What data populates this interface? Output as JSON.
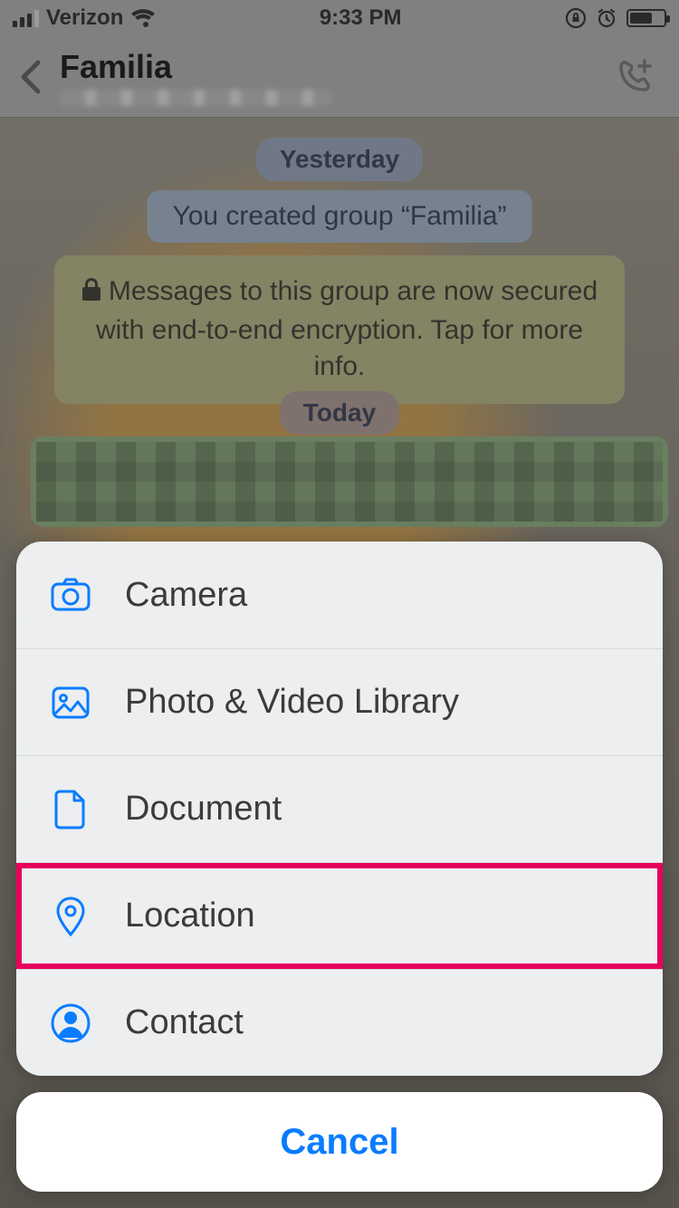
{
  "status": {
    "carrier": "Verizon",
    "time": "9:33 PM"
  },
  "header": {
    "title": "Familia"
  },
  "chat": {
    "date1": "Yesterday",
    "system_created": "You created group “Familia”",
    "encryption_notice": "Messages to this group are now secured with end-to-end encryption. Tap for more info.",
    "date2": "Today"
  },
  "sheet": {
    "items": [
      {
        "label": "Camera",
        "icon": "camera-icon",
        "highlight": false
      },
      {
        "label": "Photo & Video Library",
        "icon": "photo-icon",
        "highlight": false
      },
      {
        "label": "Document",
        "icon": "document-icon",
        "highlight": false
      },
      {
        "label": "Location",
        "icon": "location-icon",
        "highlight": true
      },
      {
        "label": "Contact",
        "icon": "contact-icon",
        "highlight": false
      }
    ],
    "cancel_label": "Cancel"
  },
  "colors": {
    "accent_blue": "#0a7cff",
    "highlight_pink": "#e6005c"
  }
}
